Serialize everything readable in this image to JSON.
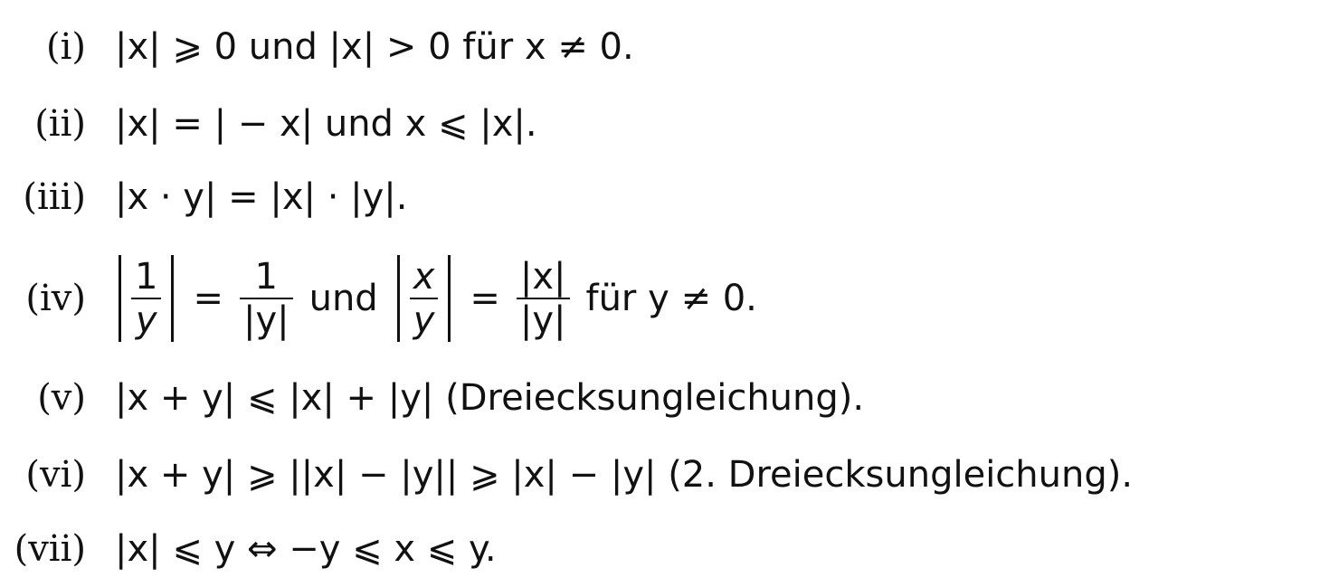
{
  "items": [
    {
      "label": "(i)",
      "text": "|x| ⩾ 0 und |x| > 0 für x ≠ 0."
    },
    {
      "label": "(ii)",
      "text": "|x| = | − x| und x ⩽ |x|."
    },
    {
      "label": "(iii)",
      "text": "|x · y| = |x| · |y|."
    },
    {
      "label": "(iv)",
      "frac1_num": "1",
      "frac1_den": "y",
      "eq1": "=",
      "frac2_num": "1",
      "frac2_den": "|y|",
      "und": "und",
      "frac3_num": "x",
      "frac3_den": "y",
      "eq2": "=",
      "frac4_num": "|x|",
      "frac4_den": "|y|",
      "tail": "für y ≠ 0."
    },
    {
      "label": "(v)",
      "text": "|x + y| ⩽ |x| + |y| (Dreiecksungleichung)."
    },
    {
      "label": "(vi)",
      "text": "|x + y| ⩾ ||x| − |y|| ⩾ |x| − |y| (2. Dreiecksungleichung)."
    },
    {
      "label": "(vii)",
      "text": "|x| ⩽ y  ⇔  −y ⩽ x ⩽ y."
    }
  ]
}
